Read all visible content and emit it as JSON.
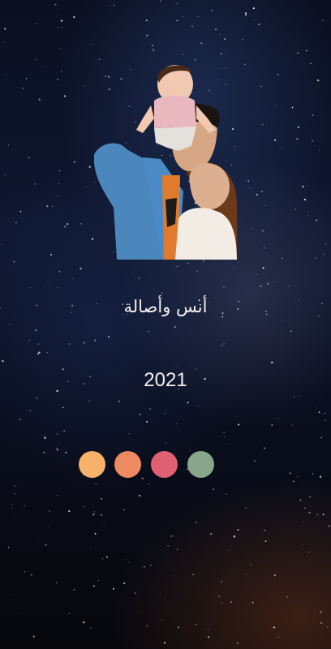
{
  "screen": {
    "title": "أنس وأصالة",
    "year": "2021"
  },
  "photo": {
    "description_icon": "family-photo"
  },
  "color_dots": [
    {
      "name": "orange-light",
      "color": "#f6b26b"
    },
    {
      "name": "coral",
      "color": "#ee8a62"
    },
    {
      "name": "red-rose",
      "color": "#e06072"
    },
    {
      "name": "sage-green",
      "color": "#8aa68a"
    }
  ]
}
